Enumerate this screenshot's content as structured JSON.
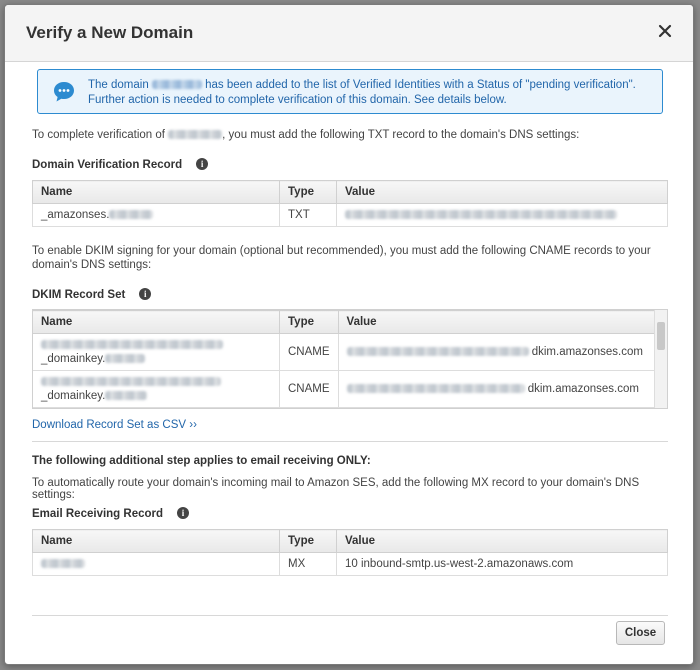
{
  "dialog": {
    "title": "Verify a New Domain",
    "close_label": "Close"
  },
  "info": {
    "text_before": "The domain ",
    "text_after": " has been added to the list of Verified Identities with a Status of \"pending verification\".",
    "line2": "Further action is needed to complete verification of this domain. See details below."
  },
  "txt_section": {
    "intro_before": "To complete verification of ",
    "intro_after": ", you must add the following TXT record to the domain's DNS settings:",
    "title": "Domain Verification Record",
    "headers": [
      "Name",
      "Type",
      "Value"
    ],
    "row": {
      "name_prefix": "_amazonses.",
      "type": "TXT"
    }
  },
  "dkim_section": {
    "intro": "To enable DKIM signing for your domain (optional but recommended), you must add the following CNAME records to your",
    "intro2": "domain's DNS settings:",
    "title": "DKIM Record Set",
    "headers": [
      "Name",
      "Type",
      "Value"
    ],
    "rows": [
      {
        "name_suffix": "_domainkey.",
        "type": "CNAME",
        "value_suffix": "dkim.amazonses.com"
      },
      {
        "name_suffix": "_domainkey.",
        "type": "CNAME",
        "value_suffix": "dkim.amazonses.com"
      }
    ],
    "download_link": "Download Record Set as CSV ››"
  },
  "receiving_section": {
    "heading": "The following additional step applies to email receiving ONLY:",
    "intro": "To automatically route your domain's incoming mail to Amazon SES, add the following MX record to your domain's DNS settings:",
    "title": "Email Receiving Record",
    "headers": [
      "Name",
      "Type",
      "Value"
    ],
    "row": {
      "type": "MX",
      "value": "10 inbound-smtp.us-west-2.amazonaws.com"
    }
  },
  "colors": {
    "info_border": "#2d8bd0",
    "info_text": "#2266aa",
    "link": "#2266aa"
  }
}
